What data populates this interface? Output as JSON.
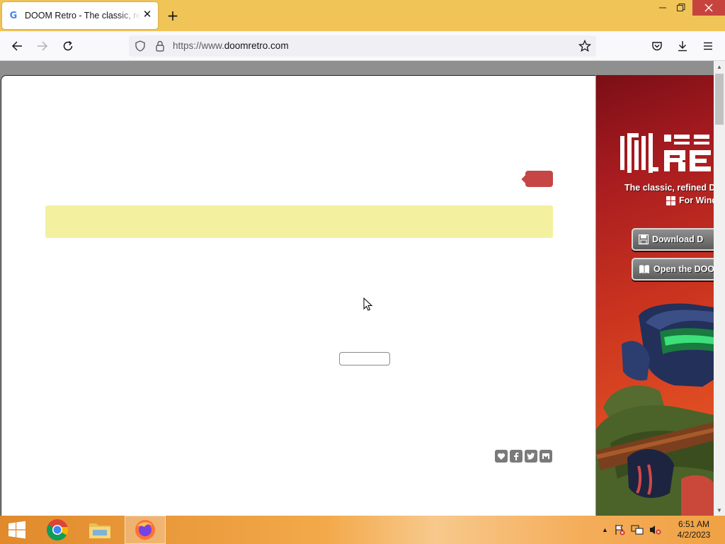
{
  "browser": {
    "tab": {
      "title": "DOOM Retro - The classic, refined DOOM source port",
      "favicon": "G"
    },
    "url": {
      "prefix": "https://www.",
      "domain": "doomretro.com"
    }
  },
  "sidebar": {
    "tagline": "The classic, refined D",
    "platform": "For Wind",
    "download_label": "Download D",
    "wiki_label": "Open the DOO"
  },
  "taskbar": {
    "time": "6:51 AM",
    "date": "4/2/2023"
  },
  "colors": {
    "tabbar": "#f0c457",
    "accent_red": "#c64545",
    "ad_banner": "#f3f1a0",
    "sidebar_red": "#a81c20"
  }
}
